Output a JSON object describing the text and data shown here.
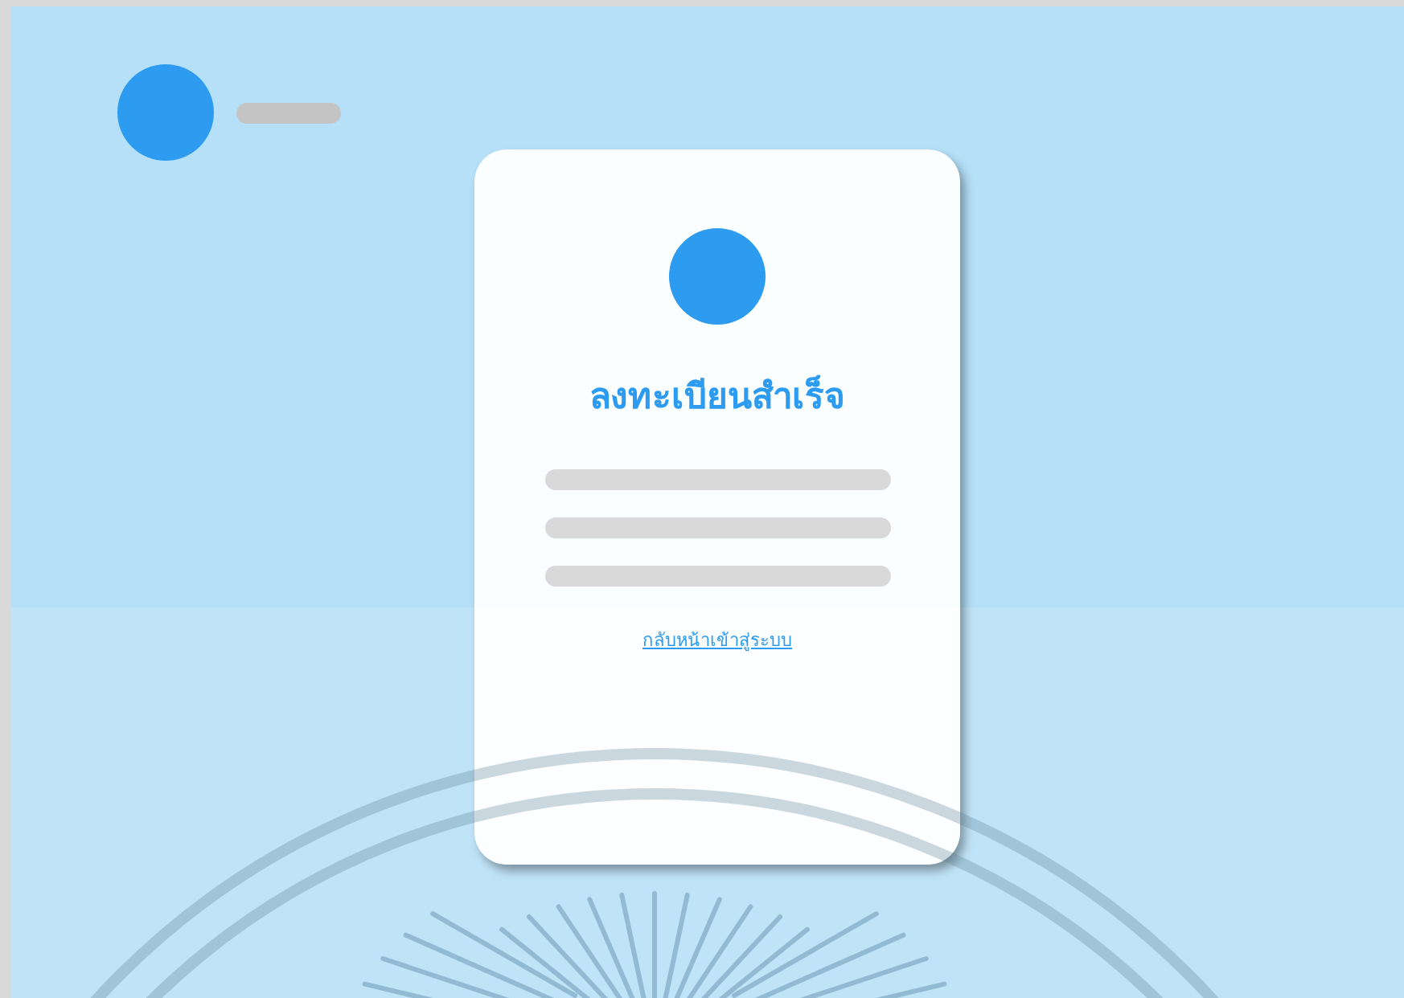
{
  "card": {
    "title": "ลงทะเบียนสำเร็จ",
    "link": "กลับหน้าเข้าสู่ระบบ"
  }
}
